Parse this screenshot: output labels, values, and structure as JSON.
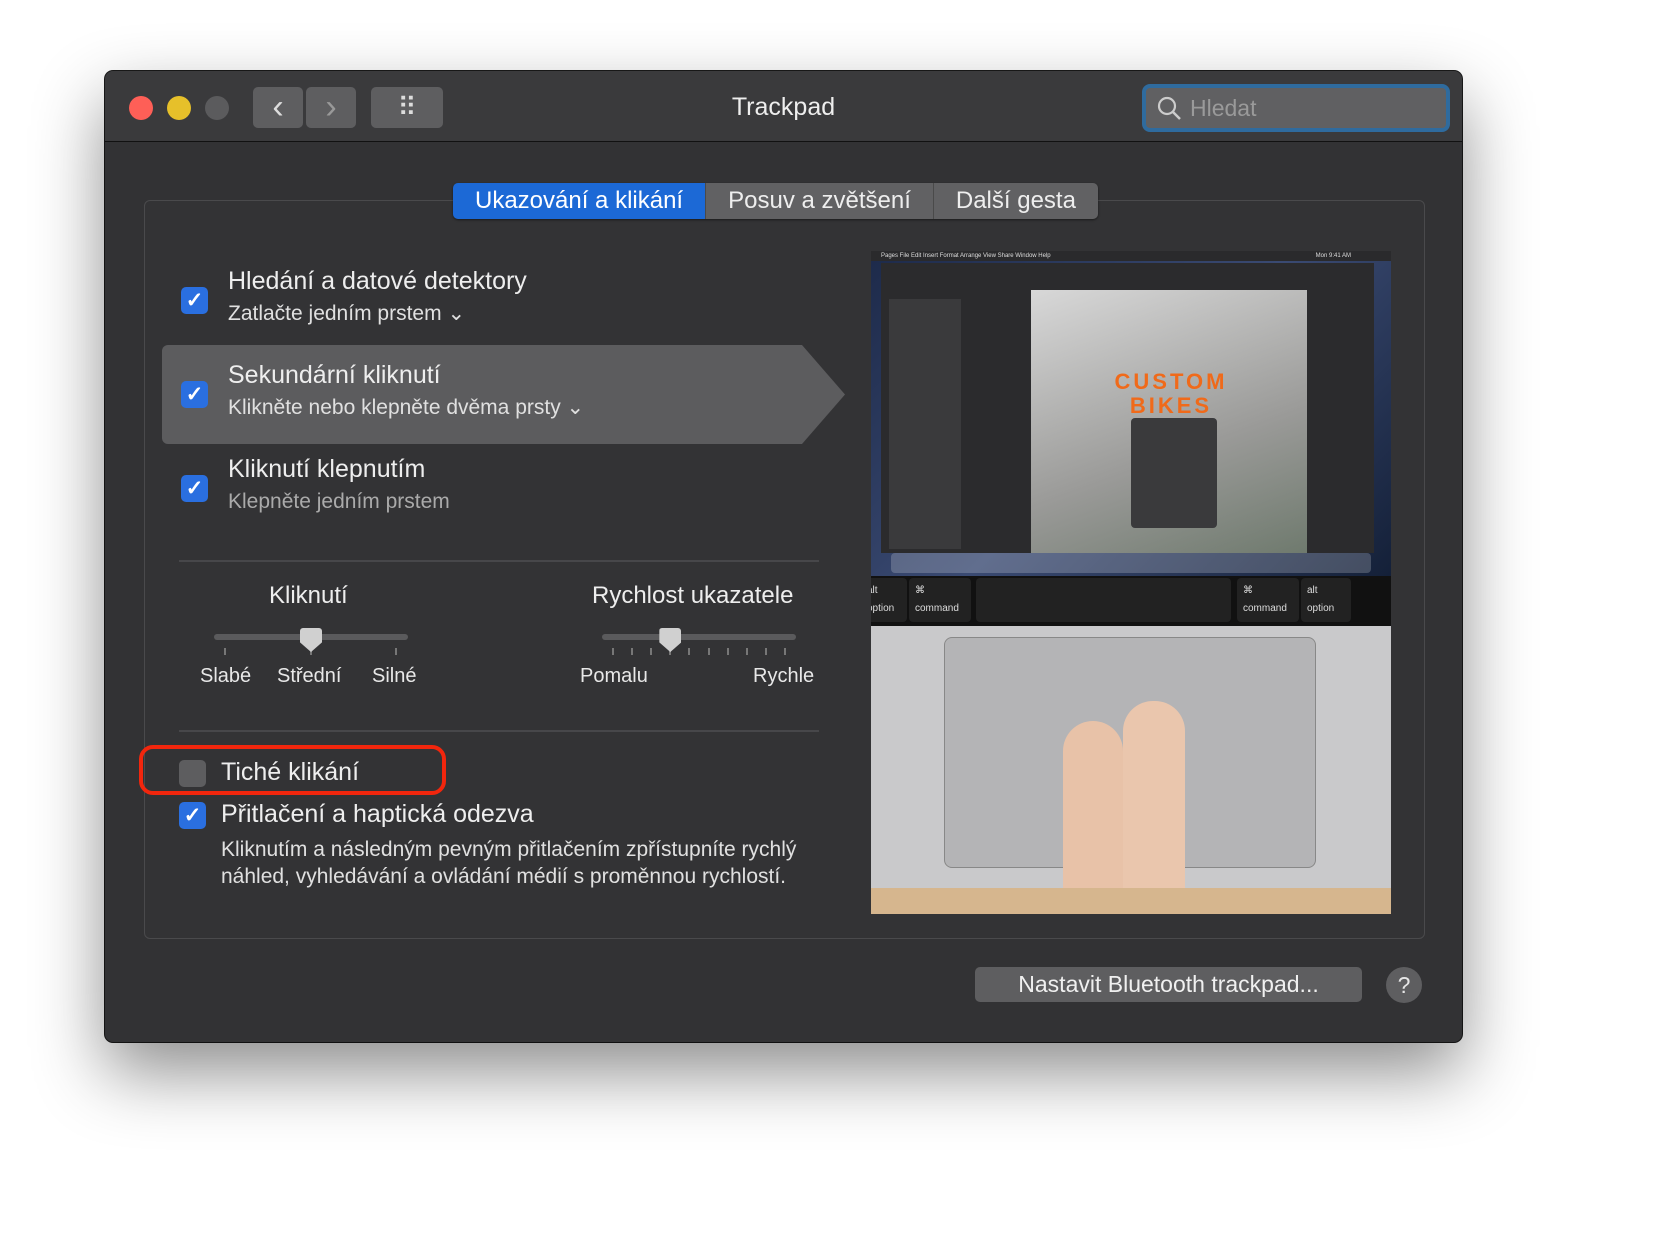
{
  "window": {
    "title": "Trackpad",
    "search_placeholder": "Hledat"
  },
  "toolbar": {
    "back": "‹",
    "forward": "›",
    "grid": "⠿"
  },
  "tabs": [
    {
      "label": "Ukazování a klikání",
      "active": true
    },
    {
      "label": "Posuv a zvětšení",
      "active": false
    },
    {
      "label": "Další gesta",
      "active": false
    }
  ],
  "options": [
    {
      "label": "Hledání a datové detektory",
      "sub": "Zatlačte jedním prstem",
      "checked": true,
      "dropdown": true
    },
    {
      "label": "Sekundární kliknutí",
      "sub": "Klikněte nebo klepněte dvěma prsty",
      "checked": true,
      "dropdown": true,
      "selected": true
    },
    {
      "label": "Kliknutí klepnutím",
      "sub": "Klepněte jedním prstem",
      "checked": true,
      "dropdown": false
    }
  ],
  "sliders": {
    "click": {
      "title": "Kliknutí",
      "labels": [
        "Slabé",
        "Střední",
        "Silné"
      ],
      "value_index": 1,
      "ticks": 3
    },
    "speed": {
      "title": "Rychlost ukazatele",
      "labels": [
        "Pomalu",
        "Rychle"
      ],
      "value_index": 3,
      "ticks": 10
    }
  },
  "silent_click": {
    "label": "Tiché klikání",
    "checked": false,
    "highlight_color": "#f2260d"
  },
  "force_click": {
    "label": "Přitlačení a haptická odezva",
    "checked": true,
    "description": "Kliknutím a následným pevným přitlačením zpřístupníte rychlý náhled, vyhledávání a ovládání médií s proměnnou rychlostí."
  },
  "preview": {
    "menubar": "Pages  File  Edit  Insert  Format  Arrange  View  Share  Window  Help",
    "clock": "Mon 9:41 AM",
    "doc_title": "CUSTOM BIKES",
    "keys": [
      {
        "top": "alt",
        "bottom": "option"
      },
      {
        "top": "⌘",
        "bottom": "command"
      },
      {
        "top": "⌘",
        "bottom": "command"
      },
      {
        "top": "alt",
        "bottom": "option"
      }
    ]
  },
  "footer": {
    "bluetooth_button": "Nastavit Bluetooth trackpad...",
    "help": "?"
  },
  "colors": {
    "accent": "#1c69d6",
    "window_bg": "#323234"
  }
}
